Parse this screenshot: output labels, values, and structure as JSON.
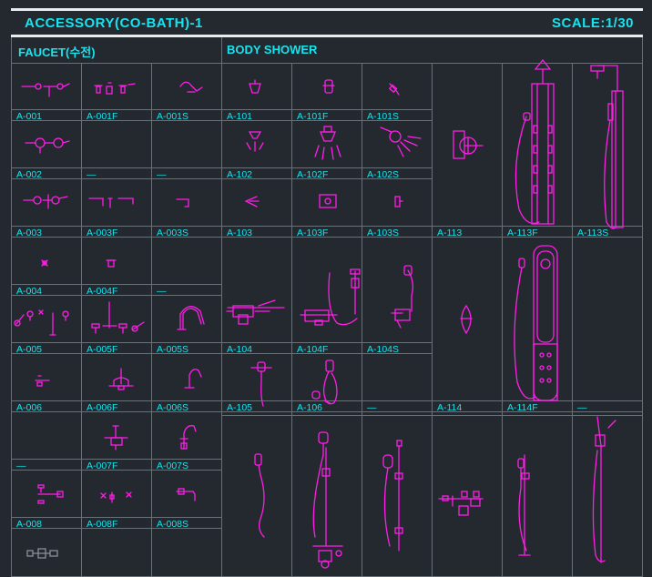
{
  "header": {
    "title": "ACCESSORY(CO-BATH)-1",
    "scale": "SCALE:1/30"
  },
  "sections": {
    "faucet": "FAUCET(수전)",
    "body_shower": "BODY SHOWER"
  },
  "faucet_labels": {
    "A001": "A-001",
    "A001F": "A-001F",
    "A001S": "A-001S",
    "A002": "A-002",
    "A002F": "—",
    "A002S": "—",
    "A003": "A-003",
    "A003F": "A-003F",
    "A003S": "A-003S",
    "A004": "A-004",
    "A004F": "A-004F",
    "A004S": "—",
    "A005": "A-005",
    "A005F": "A-005F",
    "A005S": "A-005S",
    "A006": "A-006",
    "A006F": "A-006F",
    "A006S": "A-006S",
    "A007": "—",
    "A007F": "A-007F",
    "A007S": "A-007S",
    "A008": "A-008",
    "A008F": "A-008F",
    "A008S": "A-008S"
  },
  "shower_labels": {
    "A101": "A-101",
    "A101F": "A-101F",
    "A101S": "A-101S",
    "A102": "A-102",
    "A102F": "A-102F",
    "A102S": "A-102S",
    "A103": "A-103",
    "A103F": "A-103F",
    "A103S": "A-103S",
    "A104": "A-104",
    "A104F": "A-104F",
    "A104S": "A-104S",
    "A105": "A-105",
    "A106": "A-106",
    "A106S": "—",
    "A113": "A-113",
    "A113F": "A-113F",
    "A113S": "A-113S",
    "A114": "A-114",
    "A114F": "A-114F",
    "A114S": "—"
  },
  "colors": {
    "background": "#24292f",
    "text": "#18e3ee",
    "drawing": "#ff1ee6",
    "grid": "#6a7078"
  }
}
